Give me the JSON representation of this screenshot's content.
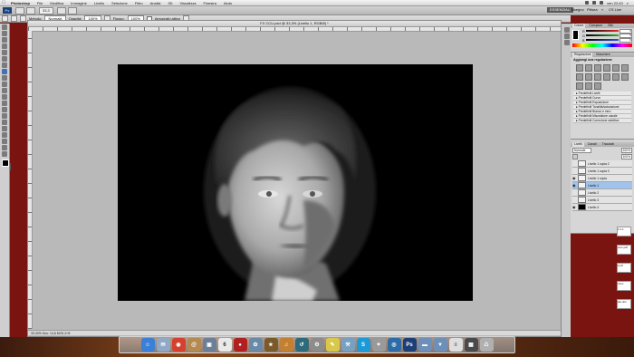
{
  "menubar": {
    "apple": "",
    "app_name": "Photoshop",
    "items": [
      "File",
      "Modifica",
      "Immagine",
      "Livello",
      "Selezione",
      "Filtro",
      "Analisi",
      "3D",
      "Visualizza",
      "Finestra",
      "Aiuto"
    ],
    "clock": "ven 22:43",
    "spotlight": "⌕"
  },
  "appbar": {
    "ps_label": "Ps",
    "zoom_value": "33,3",
    "workspace_active": "ESSENZIALI",
    "workspace_links": [
      "Disegno",
      "Pittura",
      "»"
    ],
    "cs_live": "CS Live"
  },
  "options": {
    "label_mode": "Metodo:",
    "mode_value": "Normale",
    "label_opacity": "Opacità:",
    "opacity_value": "100%",
    "label_flow": "Flusso:",
    "flow_value": "100%",
    "airbrush_label": "Aerografo attivo"
  },
  "document": {
    "title": "FX CCU.psd @ 33,3% (Livello 1, RGB/8) *",
    "status": "33,33%   Doc: 14,6 M/31,9 M"
  },
  "color_panel": {
    "tabs": [
      "Colore",
      "Campioni",
      "Stili"
    ],
    "sliders": [
      {
        "label": "R",
        "value": "0",
        "color": "#e03030"
      },
      {
        "label": "G",
        "value": "0",
        "color": "#30b030"
      },
      {
        "label": "B",
        "value": "0",
        "color": "#3050e0"
      }
    ]
  },
  "adjust_panel": {
    "tabs": [
      "Regolazioni",
      "Maschere"
    ],
    "heading": "Aggiungi una regolazione",
    "presets": [
      "▸ Predefiniti Livelli",
      "▸ Predefiniti Curve",
      "▸ Predefiniti Esposizione",
      "▸ Predefiniti Tonalità/saturazione",
      "▸ Predefiniti Bianco e nero",
      "▸ Predefiniti Miscelatore canale",
      "▸ Predefiniti Correzione selettiva"
    ]
  },
  "layers_panel": {
    "tabs": [
      "Livelli",
      "Canali",
      "Tracciati"
    ],
    "blend_mode": "Normale",
    "opacity": "100%",
    "fill": "100%",
    "layers": [
      {
        "name": "Livello 1 copia 2",
        "thumb": "white",
        "selected": false,
        "visible": false
      },
      {
        "name": "Livello 1 copia 3",
        "thumb": "white",
        "selected": false,
        "visible": false
      },
      {
        "name": "Livello 1 copia",
        "thumb": "white",
        "selected": false,
        "visible": true
      },
      {
        "name": "Livello 1",
        "thumb": "white",
        "selected": true,
        "visible": true
      },
      {
        "name": "Livello 2",
        "thumb": "white",
        "selected": false,
        "visible": false
      },
      {
        "name": "Livello 3",
        "thumb": "white",
        "selected": false,
        "visible": false
      },
      {
        "name": "Livello 4",
        "thumb": "black",
        "selected": false,
        "visible": true
      }
    ]
  },
  "desktop": {
    "file_labels": [
      "2.1.1",
      "vero.pdf",
      "l.pdf",
      "l.doc",
      "ate.doc"
    ]
  },
  "dock": {
    "apps": [
      {
        "name": "Finder",
        "glyph": "☺",
        "color": "#3a7fd8"
      },
      {
        "name": "Mail",
        "glyph": "✉",
        "color": "#8fa9c7"
      },
      {
        "name": "Chrome",
        "glyph": "◉",
        "color": "#d6402e"
      },
      {
        "name": "Indirizzi",
        "glyph": "@",
        "color": "#b38a51"
      },
      {
        "name": "Anteprima",
        "glyph": "▣",
        "color": "#6b7f99"
      },
      {
        "name": "iCal",
        "glyph": "6",
        "color": "#e9e9e9"
      },
      {
        "name": "Photo Booth",
        "glyph": "●",
        "color": "#b02020"
      },
      {
        "name": "iPhoto",
        "glyph": "✿",
        "color": "#6a8aa8"
      },
      {
        "name": "iMovie",
        "glyph": "★",
        "color": "#7a5a2a"
      },
      {
        "name": "GarageBand",
        "glyph": "♫",
        "color": "#c28030"
      },
      {
        "name": "Time Machine",
        "glyph": "↺",
        "color": "#2d6b7a"
      },
      {
        "name": "Preferenze",
        "glyph": "⚙",
        "color": "#8c8c8c"
      },
      {
        "name": "Note",
        "glyph": "✎",
        "color": "#d9c84a"
      },
      {
        "name": "Utility",
        "glyph": "⚒",
        "color": "#7aa0c0"
      },
      {
        "name": "Skype",
        "glyph": "S",
        "color": "#1a9ad8"
      },
      {
        "name": "App",
        "glyph": "✦",
        "color": "#9a9a9a"
      },
      {
        "name": "Safari",
        "glyph": "◎",
        "color": "#2e6ca8"
      },
      {
        "name": "Photoshop",
        "glyph": "Ps",
        "color": "#1c3f77"
      },
      {
        "name": "Cartella",
        "glyph": "▬",
        "color": "#6d8fb8"
      },
      {
        "name": "Download",
        "glyph": "▼",
        "color": "#6d8fb8"
      },
      {
        "name": "Documento",
        "glyph": "≡",
        "color": "#dedede"
      },
      {
        "name": "Stack",
        "glyph": "▦",
        "color": "#4a4a4a"
      },
      {
        "name": "Cestino",
        "glyph": "♺",
        "color": "#b0b0b0"
      }
    ]
  }
}
